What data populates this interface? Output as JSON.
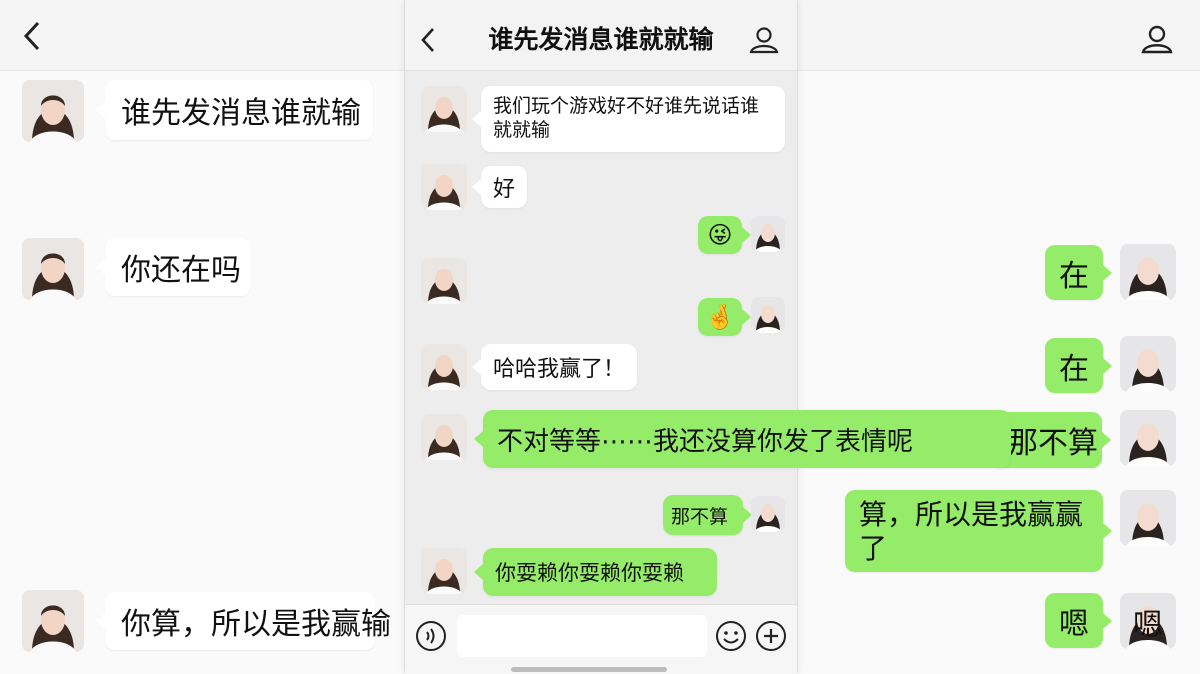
{
  "chat": {
    "title": "谁先发消息谁就就输"
  },
  "left_panel": {
    "messages": [
      {
        "text": "谁先发消息谁就输"
      },
      {
        "text": "你还在吗"
      },
      {
        "text": "你算，所以是我赢输"
      }
    ]
  },
  "right_panel": {
    "messages": [
      {
        "text": "在"
      },
      {
        "text": "在"
      },
      {
        "text": "那不算"
      },
      {
        "text": "算，所以是我赢赢了"
      },
      {
        "text": "嗯"
      },
      {
        "text": "嗯"
      }
    ]
  },
  "phone_messages": [
    {
      "text": "我们玩个游戏好不好谁先说话谁就就输"
    },
    {
      "text": "好"
    },
    {
      "text": "😜"
    },
    {
      "text": "🤞"
    },
    {
      "text": "哈哈我赢了！"
    },
    {
      "text": "不对等等⋯⋯我还没算你发了表情呢"
    },
    {
      "text": "那不算"
    },
    {
      "text": "你耍赖你耍赖你耍赖"
    }
  ],
  "colors": {
    "sent_bubble": "#95ec69",
    "received_bubble": "#ffffff",
    "chat_background": "#ededed"
  },
  "icons": [
    "back-chevron-icon",
    "contact-profile-icon",
    "voice-icon",
    "emoji-icon",
    "plus-icon"
  ]
}
